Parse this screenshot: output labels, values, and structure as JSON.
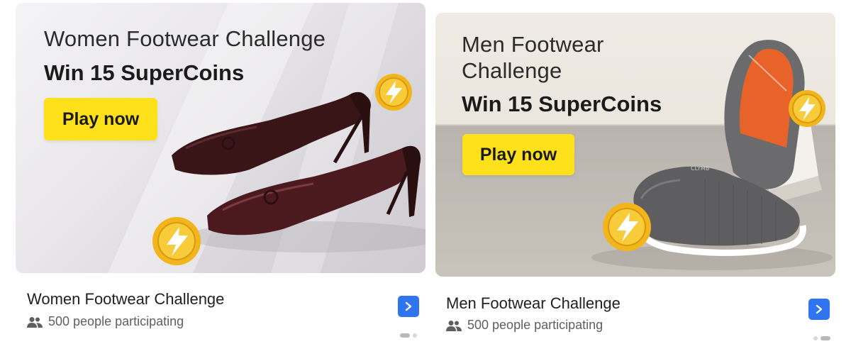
{
  "cards": [
    {
      "banner": {
        "title": "Women Footwear Challenge",
        "subtitle": "Win 15 SuperCoins",
        "cta": "Play now"
      },
      "caption": {
        "title": "Women Footwear Challenge",
        "participants": "500 people participating"
      },
      "carousel": {
        "active_index": 0,
        "total": 2
      }
    },
    {
      "banner": {
        "title": "Men Footwear Challenge",
        "subtitle": "Win 15 SuperCoins",
        "cta": "Play now",
        "brand_text": "CLYMB"
      },
      "caption": {
        "title": "Men Footwear Challenge",
        "participants": "500 people participating"
      },
      "carousel": {
        "active_index": 1,
        "total": 2
      }
    }
  ],
  "colors": {
    "cta_yellow": "#ffe11b",
    "arrow_blue": "#2f74f0",
    "coin_gold": "#f2b61c"
  },
  "icons": [
    "supercoin-icon",
    "people-icon",
    "chevron-right-icon"
  ]
}
